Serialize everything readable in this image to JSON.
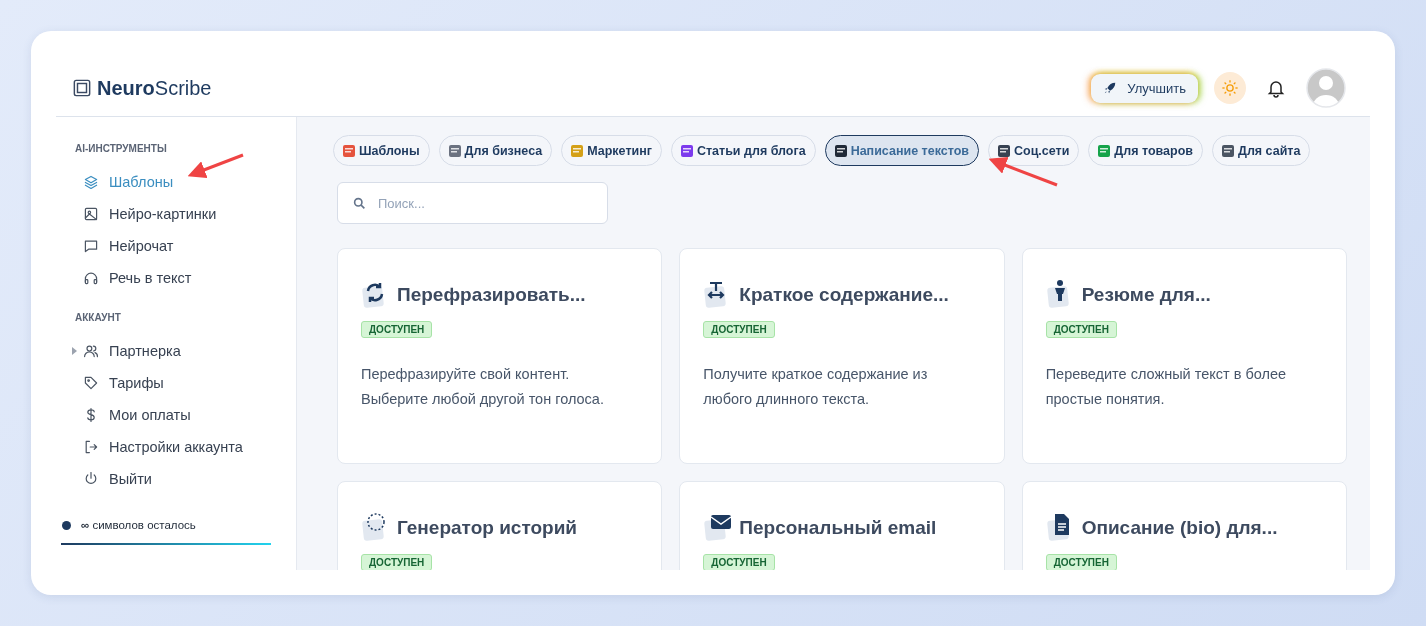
{
  "logo": {
    "text": "**Neuro**Scribe"
  },
  "header": {
    "upgrade_button": "Улучшить"
  },
  "sidebar": {
    "sections": [
      {
        "title": "AI-ИНСТРУМЕНТЫ",
        "items": [
          {
            "label": "Шаблоны",
            "selected": true
          },
          {
            "label": "Нейро-картинки",
            "selected": false
          },
          {
            "label": "Нейрочат",
            "selected": false
          },
          {
            "label": "Речь в текст",
            "selected": false
          }
        ]
      },
      {
        "title": "АККАУНТ",
        "items": [
          {
            "label": "Партнерка",
            "selected": false,
            "expandable": true
          },
          {
            "label": "Тарифы",
            "selected": false
          },
          {
            "label": "Мои оплаты",
            "selected": false
          },
          {
            "label": "Настройки аккаунта",
            "selected": false
          },
          {
            "label": "Выйти",
            "selected": false
          }
        ]
      }
    ],
    "credits": "**∞** символов осталось"
  },
  "categories": [
    {
      "label": "Шаблоны",
      "selected": false
    },
    {
      "label": "Для бизнеса",
      "selected": false
    },
    {
      "label": "Маркетинг",
      "selected": false
    },
    {
      "label": "Статьи для блога",
      "selected": false
    },
    {
      "label": "Написание текстов",
      "selected": true
    },
    {
      "label": "Соц.сети",
      "selected": false
    },
    {
      "label": "Для товаров",
      "selected": false
    },
    {
      "label": "Для сайта",
      "selected": false
    }
  ],
  "search": {
    "placeholder": "Поиск..."
  },
  "cards": [
    {
      "title": "Перефразировать...",
      "status": "ДОСТУПЕН",
      "description": "Перефразируйте свой контент. Выберите любой другой тон голоса."
    },
    {
      "title": "Краткое содержание...",
      "status": "ДОСТУПЕН",
      "description": "Получите краткое содержание из любого длинного текста."
    },
    {
      "title": "Резюме для...",
      "status": "ДОСТУПЕН",
      "description": "Переведите сложный текст в более простые понятия."
    },
    {
      "title": "Генератор историй",
      "status": "ДОСТУПЕН"
    },
    {
      "title": "Персональный email",
      "status": "ДОСТУПЕН"
    },
    {
      "title": "Описание (bio) для...",
      "status": "ДОСТУПЕН"
    }
  ]
}
